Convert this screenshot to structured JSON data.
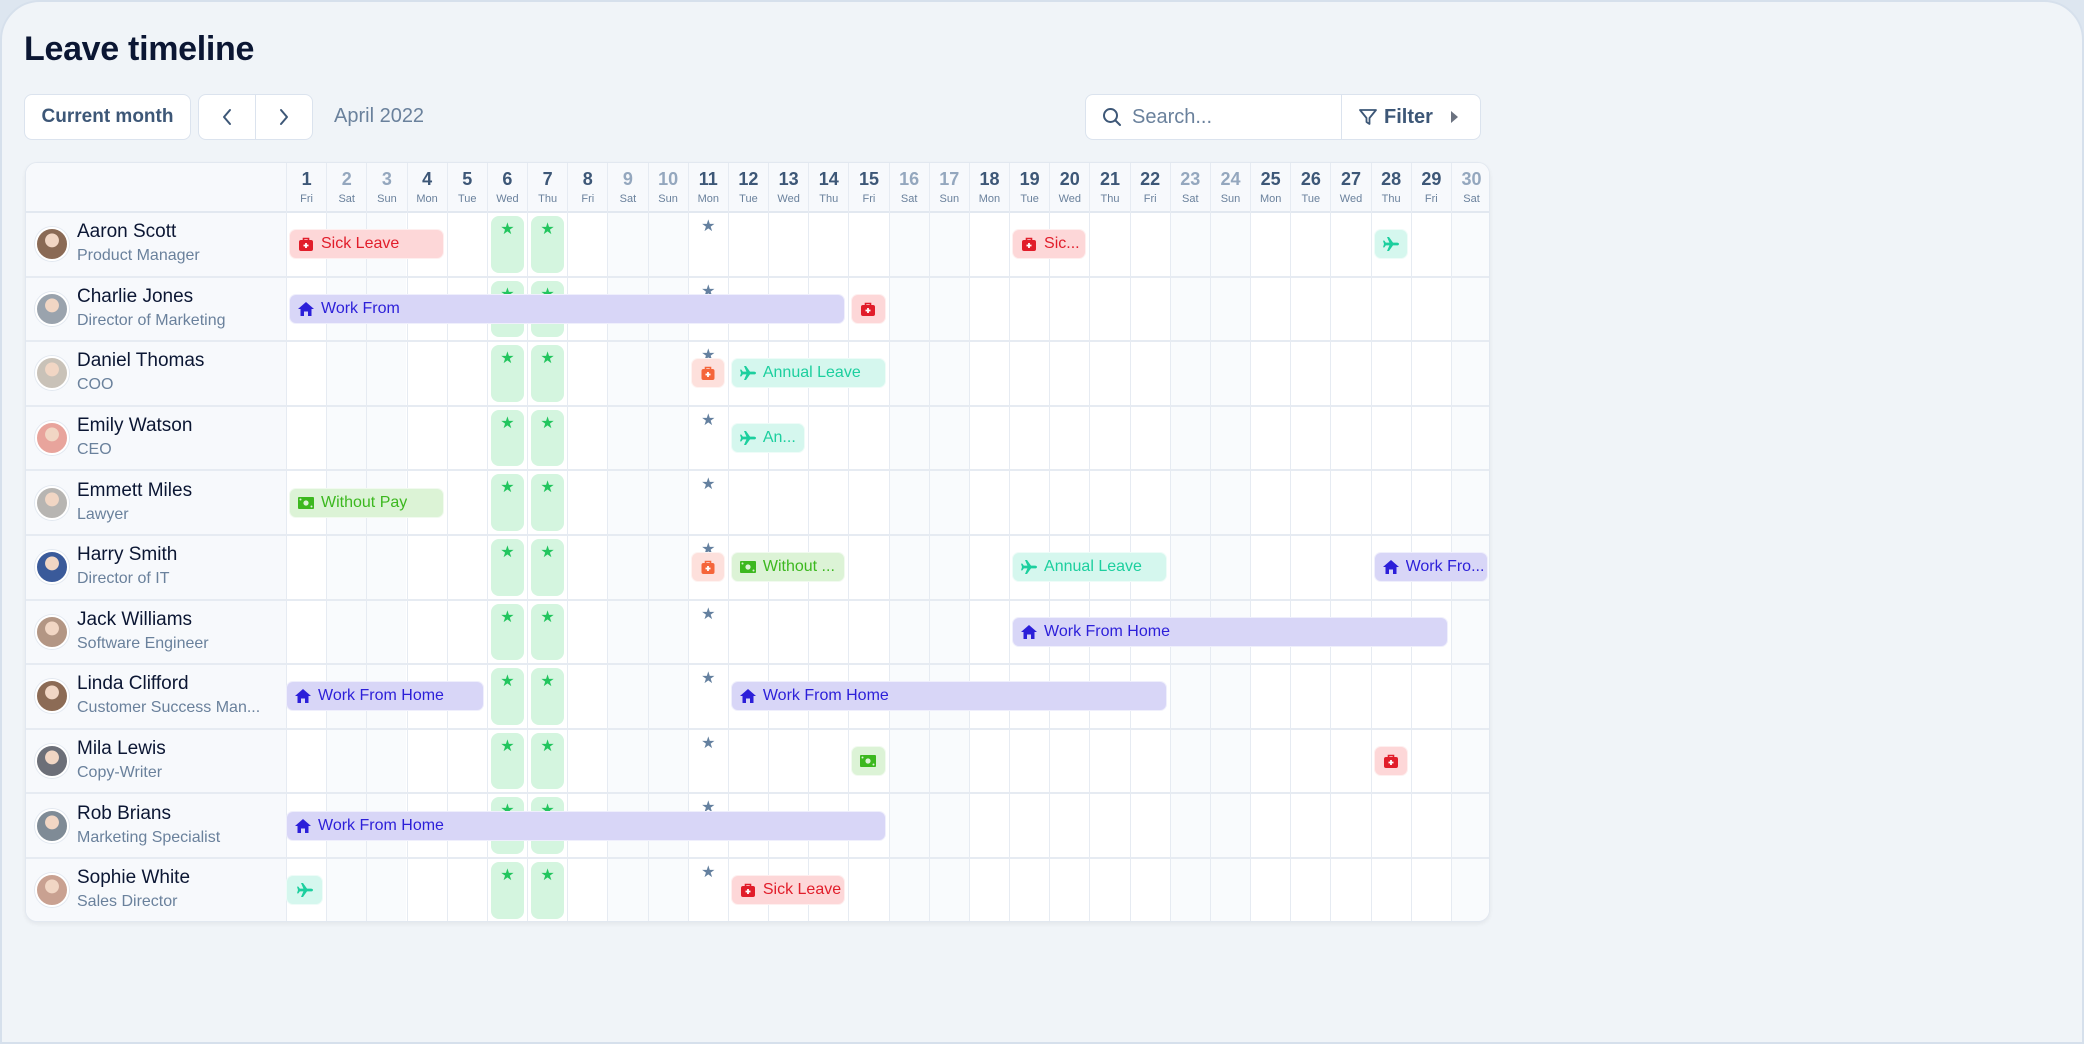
{
  "header": {
    "title": "Leave timeline",
    "current_month_label": "Current month",
    "prev_label": "‹",
    "next_label": "›",
    "month_label": "April 2022",
    "search_placeholder": "Search...",
    "filter_label": "Filter"
  },
  "icons": {
    "sick": "first-aid-kit-icon",
    "wfh": "home-icon",
    "annual": "airplane-icon",
    "nopay": "money-bill-icon",
    "other": "eject-icon",
    "holiday": "star-icon"
  },
  "colors": {
    "sick": "#e11d2a",
    "wfh": "#2c1fd9",
    "annual": "#1ccf9e",
    "nopay": "#3cb81f",
    "other": "#f5653a",
    "holiday": "#22c55e"
  },
  "days": [
    {
      "d": "1",
      "w": "Fri"
    },
    {
      "d": "2",
      "w": "Sat",
      "we": true
    },
    {
      "d": "3",
      "w": "Sun",
      "we": true
    },
    {
      "d": "4",
      "w": "Mon"
    },
    {
      "d": "5",
      "w": "Tue"
    },
    {
      "d": "6",
      "w": "Wed"
    },
    {
      "d": "7",
      "w": "Thu"
    },
    {
      "d": "8",
      "w": "Fri"
    },
    {
      "d": "9",
      "w": "Sat",
      "we": true
    },
    {
      "d": "10",
      "w": "Sun",
      "we": true
    },
    {
      "d": "11",
      "w": "Mon"
    },
    {
      "d": "12",
      "w": "Tue"
    },
    {
      "d": "13",
      "w": "Wed"
    },
    {
      "d": "14",
      "w": "Thu"
    },
    {
      "d": "15",
      "w": "Fri"
    },
    {
      "d": "16",
      "w": "Sat",
      "we": true
    },
    {
      "d": "17",
      "w": "Sun",
      "we": true
    },
    {
      "d": "18",
      "w": "Mon"
    },
    {
      "d": "19",
      "w": "Tue"
    },
    {
      "d": "20",
      "w": "Wed"
    },
    {
      "d": "21",
      "w": "Thu"
    },
    {
      "d": "22",
      "w": "Fri"
    },
    {
      "d": "23",
      "w": "Sat",
      "we": true
    },
    {
      "d": "24",
      "w": "Sun",
      "we": true
    },
    {
      "d": "25",
      "w": "Mon"
    },
    {
      "d": "26",
      "w": "Tue"
    },
    {
      "d": "27",
      "w": "Wed"
    },
    {
      "d": "28",
      "w": "Thu"
    },
    {
      "d": "29",
      "w": "Fri"
    },
    {
      "d": "30",
      "w": "Sat",
      "we": true
    }
  ],
  "public_holidays": [
    6,
    7
  ],
  "personal_star_day": 11,
  "employees": [
    {
      "name": "Aaron Scott",
      "role": "Product Manager",
      "avatar": "#8a6a55",
      "leaves": [
        {
          "type": "sick",
          "label": "Sick Leave",
          "start": 1,
          "end": 4
        },
        {
          "type": "sick",
          "label": "Sic...",
          "start": 19,
          "end": 20
        },
        {
          "type": "annual",
          "label": "",
          "start": 28,
          "end": 28
        }
      ]
    },
    {
      "name": "Charlie Jones",
      "role": "Director of Marketing",
      "avatar": "#9aa3ad",
      "leaves": [
        {
          "type": "wfh",
          "label": "Work From",
          "start": 1,
          "end": 14
        },
        {
          "type": "sick",
          "label": "",
          "start": 15,
          "end": 15
        }
      ]
    },
    {
      "name": "Daniel Thomas",
      "role": "COO",
      "avatar": "#c9c2b8",
      "leaves": [
        {
          "type": "other",
          "label": "",
          "start": 11,
          "end": 11
        },
        {
          "type": "annual",
          "label": "Annual Leave",
          "start": 12,
          "end": 15
        }
      ]
    },
    {
      "name": "Emily Watson",
      "role": "CEO",
      "avatar": "#e8a49c",
      "leaves": [
        {
          "type": "annual",
          "label": "An...",
          "start": 12,
          "end": 13
        }
      ]
    },
    {
      "name": "Emmett Miles",
      "role": "Lawyer",
      "avatar": "#b7b5b2",
      "leaves": [
        {
          "type": "nopay",
          "label": "Without Pay",
          "start": 1,
          "end": 4
        }
      ]
    },
    {
      "name": "Harry Smith",
      "role": "Director of IT",
      "avatar": "#3a5a9a",
      "leaves": [
        {
          "type": "other",
          "label": "",
          "start": 11,
          "end": 11
        },
        {
          "type": "nopay",
          "label": "Without ...",
          "start": 12,
          "end": 14
        },
        {
          "type": "annual",
          "label": "Annual Leave",
          "start": 19,
          "end": 22
        },
        {
          "type": "wfh",
          "label": "Work Fro...",
          "start": 28,
          "end": 30
        }
      ]
    },
    {
      "name": "Jack Williams",
      "role": "Software Engineer",
      "avatar": "#b39684",
      "leaves": [
        {
          "type": "wfh",
          "label": "Work From Home",
          "start": 19,
          "end": 29
        }
      ]
    },
    {
      "name": "Linda Clifford",
      "role": "Customer Success Man...",
      "avatar": "#8c6b55",
      "leaves": [
        {
          "type": "wfh",
          "label": "Work From Home",
          "start": 1,
          "end": 5
        },
        {
          "type": "wfh",
          "label": "Work From Home",
          "start": 12,
          "end": 22
        }
      ]
    },
    {
      "name": "Mila Lewis",
      "role": "Copy-Writer",
      "avatar": "#6c6f78",
      "leaves": [
        {
          "type": "nopay",
          "label": "",
          "start": 15,
          "end": 15
        },
        {
          "type": "sick",
          "label": "",
          "start": 28,
          "end": 28
        }
      ]
    },
    {
      "name": "Rob Brians",
      "role": "Marketing Specialist",
      "avatar": "#7f8b96",
      "leaves": [
        {
          "type": "wfh",
          "label": "Work From Home",
          "start": 1,
          "end": 15
        }
      ]
    },
    {
      "name": "Sophie White",
      "role": "Sales Director",
      "avatar": "#c9a191",
      "leaves": [
        {
          "type": "annual",
          "label": "",
          "start": 1,
          "end": 1
        },
        {
          "type": "sick",
          "label": "Sick Leave",
          "start": 12,
          "end": 14
        }
      ]
    }
  ]
}
